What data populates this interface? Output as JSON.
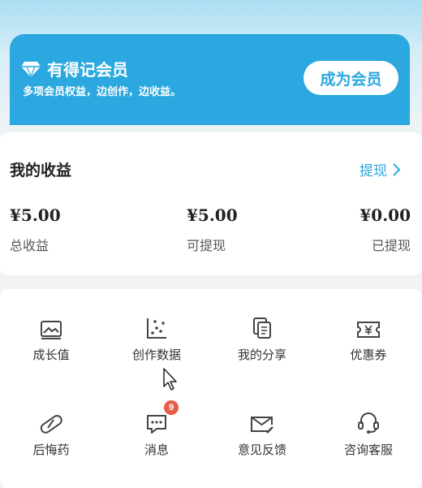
{
  "member": {
    "title": "有得记会员",
    "subtitle": "多项会员权益，边创作，边收益。",
    "button": "成为会员",
    "icon": "diamond-icon"
  },
  "earnings": {
    "title": "我的收益",
    "withdraw_link": "提现",
    "stats": [
      {
        "amount": "¥5.00",
        "label": "总收益"
      },
      {
        "amount": "¥5.00",
        "label": "可提现"
      },
      {
        "amount": "¥0.00",
        "label": "已提现"
      }
    ]
  },
  "menu": {
    "items": [
      {
        "label": "成长值",
        "icon": "growth-image-icon"
      },
      {
        "label": "创作数据",
        "icon": "scatter-chart-icon"
      },
      {
        "label": "我的分享",
        "icon": "copy-document-icon"
      },
      {
        "label": "优惠券",
        "icon": "coupon-ticket-icon"
      },
      {
        "label": "后悔药",
        "icon": "pill-icon"
      },
      {
        "label": "消息",
        "icon": "message-chat-icon",
        "badge": "9"
      },
      {
        "label": "意见反馈",
        "icon": "feedback-mail-icon"
      },
      {
        "label": "咨询客服",
        "icon": "headset-icon"
      }
    ]
  },
  "colors": {
    "accent": "#2aa8df",
    "badge": "#e85d4a"
  }
}
